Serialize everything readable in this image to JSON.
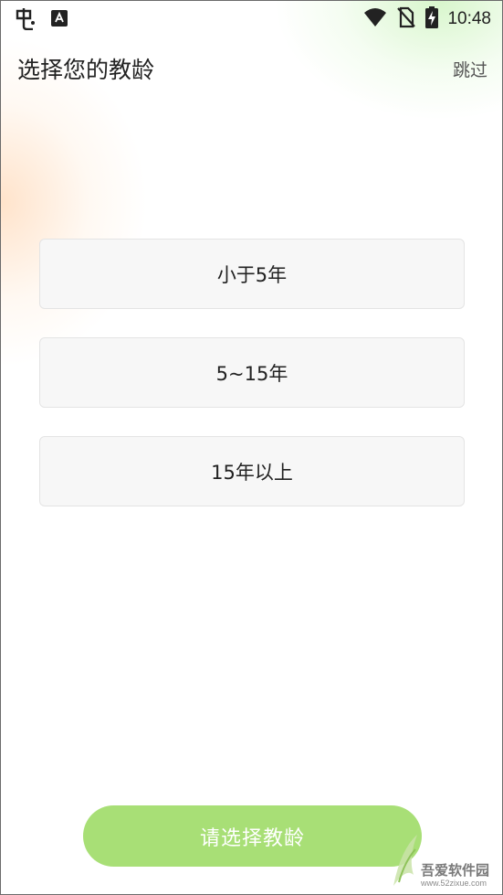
{
  "status_bar": {
    "time": "10:48",
    "icons": [
      "app-notification-icon",
      "keyboard-a-icon",
      "wifi-icon",
      "no-sim-icon",
      "battery-charging-icon"
    ]
  },
  "header": {
    "title": "选择您的教龄",
    "skip_label": "跳过"
  },
  "options": [
    {
      "label": "小于5年"
    },
    {
      "label": "5~15年"
    },
    {
      "label": "15年以上"
    }
  ],
  "submit": {
    "label": "请选择教龄"
  },
  "colors": {
    "accent_green": "#a8df76",
    "option_bg": "#f7f7f7",
    "option_border": "#e4e4e4"
  },
  "watermark": {
    "logo_text": "吾爱软件园",
    "url": "www.52zixue.com"
  }
}
